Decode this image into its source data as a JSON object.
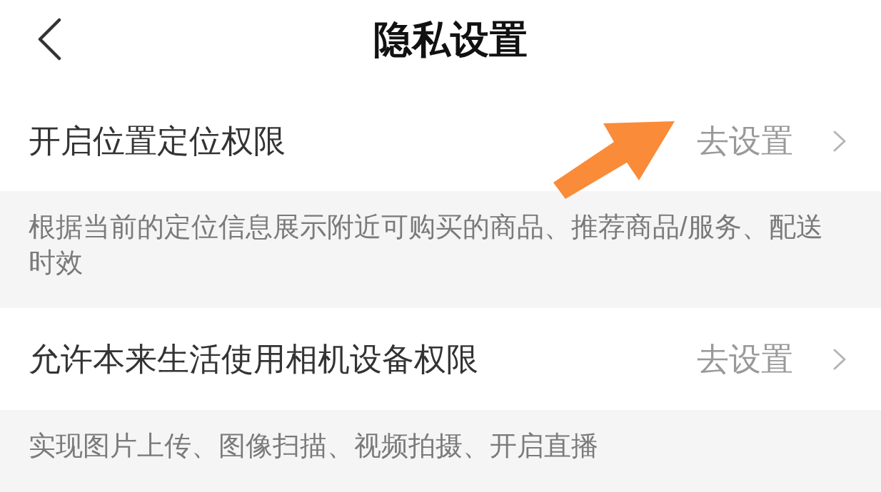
{
  "header": {
    "title": "隐私设置"
  },
  "permissions": [
    {
      "title": "开启位置定位权限",
      "action": "去设置",
      "description": "根据当前的定位信息展示附近可购买的商品、推荐商品/服务、配送时效"
    },
    {
      "title": "允许本来生活使用相机设备权限",
      "action": "去设置",
      "description": "实现图片上传、图像扫描、视频拍摄、开启直播"
    }
  ]
}
